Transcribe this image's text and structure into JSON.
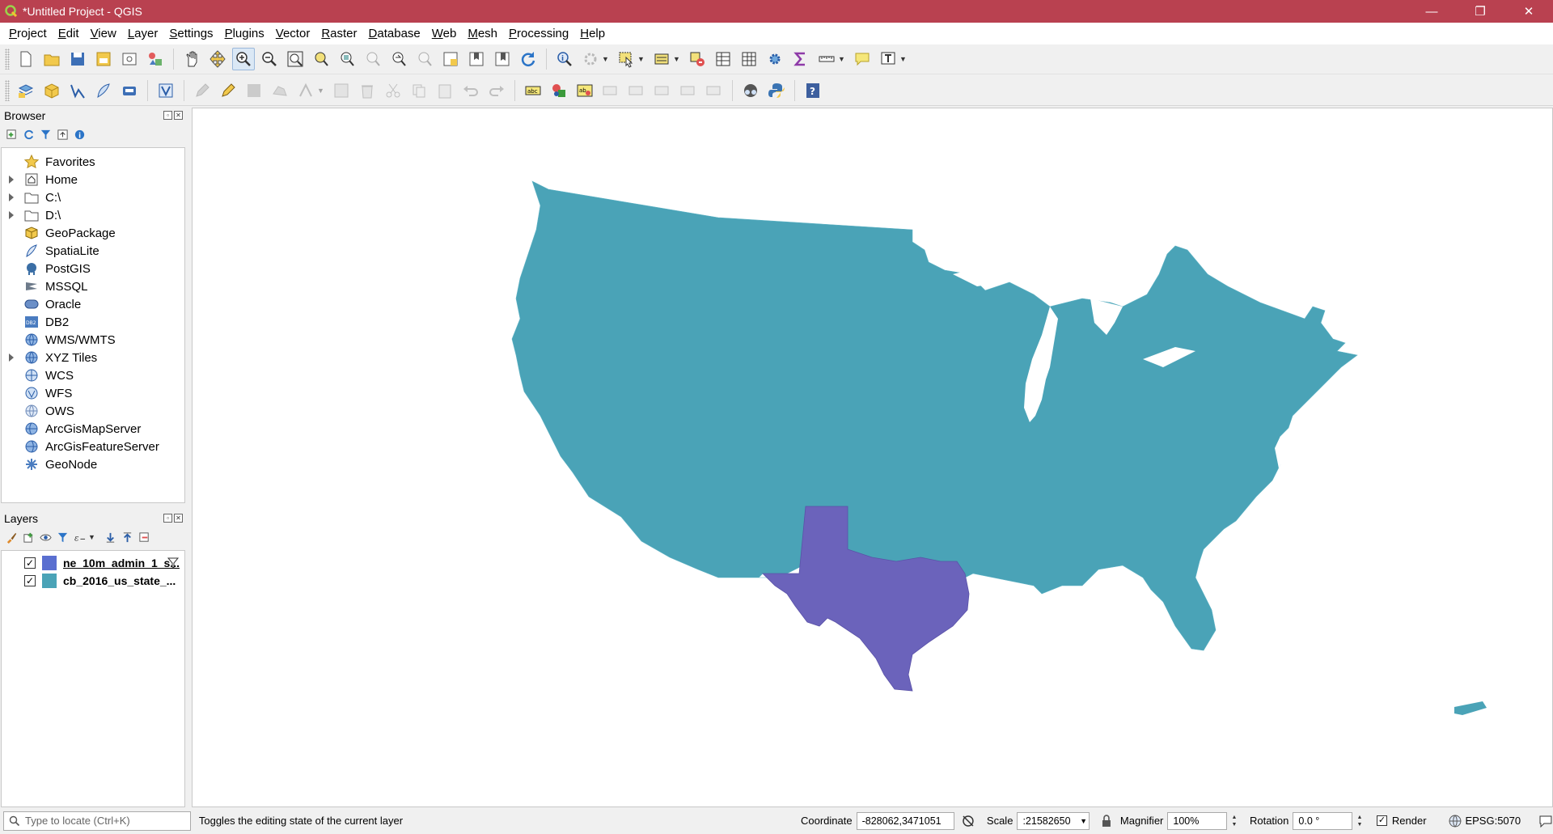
{
  "window": {
    "title": "*Untitled Project - QGIS",
    "minimize": "—",
    "restore": "❐",
    "close": "✕"
  },
  "menu": [
    "Project",
    "Edit",
    "View",
    "Layer",
    "Settings",
    "Plugins",
    "Vector",
    "Raster",
    "Database",
    "Web",
    "Mesh",
    "Processing",
    "Help"
  ],
  "browser": {
    "title": "Browser",
    "items": [
      {
        "label": "Favorites",
        "expandable": false
      },
      {
        "label": "Home",
        "expandable": true
      },
      {
        "label": "C:\\",
        "expandable": true
      },
      {
        "label": "D:\\",
        "expandable": true
      },
      {
        "label": "GeoPackage",
        "expandable": false
      },
      {
        "label": "SpatiaLite",
        "expandable": false
      },
      {
        "label": "PostGIS",
        "expandable": false
      },
      {
        "label": "MSSQL",
        "expandable": false
      },
      {
        "label": "Oracle",
        "expandable": false
      },
      {
        "label": "DB2",
        "expandable": false
      },
      {
        "label": "WMS/WMTS",
        "expandable": false
      },
      {
        "label": "XYZ Tiles",
        "expandable": true
      },
      {
        "label": "WCS",
        "expandable": false
      },
      {
        "label": "WFS",
        "expandable": false
      },
      {
        "label": "OWS",
        "expandable": false
      },
      {
        "label": "ArcGisMapServer",
        "expandable": false
      },
      {
        "label": "ArcGisFeatureServer",
        "expandable": false
      },
      {
        "label": "GeoNode",
        "expandable": false
      }
    ]
  },
  "layers": {
    "title": "Layers",
    "items": [
      {
        "name": "ne_10m_admin_1_s...",
        "color": "#5a6fd0",
        "checked": true,
        "selected": true
      },
      {
        "name": "cb_2016_us_state_...",
        "color": "#4aa3b7",
        "checked": true,
        "selected": false
      }
    ]
  },
  "map": {
    "state_fill": "#4aa3b7",
    "highlight_fill": "#6b63bb",
    "background": "#ffffff"
  },
  "status": {
    "locator_placeholder": "Type to locate (Ctrl+K)",
    "message": "Toggles the editing state of the current layer",
    "coordinate_label": "Coordinate",
    "coordinate": "-828062,3471051",
    "scale_label": "Scale",
    "scale": ":21582650",
    "magnifier_label": "Magnifier",
    "magnifier": "100%",
    "rotation_label": "Rotation",
    "rotation": "0.0 °",
    "render_label": "Render",
    "crs": "EPSG:5070"
  }
}
